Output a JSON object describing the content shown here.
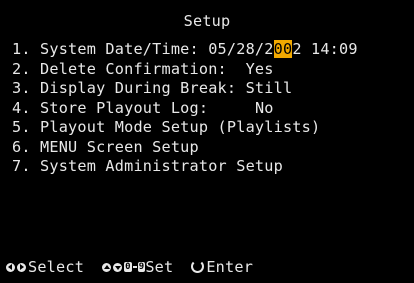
{
  "screen": {
    "title": "Setup",
    "highlight_color": "#f2a900",
    "text_color": "#e8e8e8",
    "background_color": "#000000"
  },
  "menu": {
    "items": [
      {
        "number": "1.",
        "label": "System Date/Time:",
        "value_pre": "05/28/2",
        "value_highlight": "00",
        "value_post": "2 14:09"
      },
      {
        "number": "2.",
        "label": "Delete Confirmation:",
        "value": "Yes"
      },
      {
        "number": "3.",
        "label": "Display During Break:",
        "value": "Still"
      },
      {
        "number": "4.",
        "label": "Store Playout Log:",
        "value": "No"
      },
      {
        "number": "5.",
        "label": "Playout Mode Setup (Playlists)"
      },
      {
        "number": "6.",
        "label": "MENU Screen Setup"
      },
      {
        "number": "7.",
        "label": "System Administrator Setup"
      }
    ]
  },
  "footer": {
    "select_label": "Select",
    "numkey_start": "0",
    "numkey_end": "9",
    "set_label": "Set",
    "enter_label": "Enter",
    "icons": [
      "left-arrow-icon",
      "right-arrow-icon",
      "up-arrow-icon",
      "down-arrow-icon",
      "enter-icon"
    ]
  }
}
